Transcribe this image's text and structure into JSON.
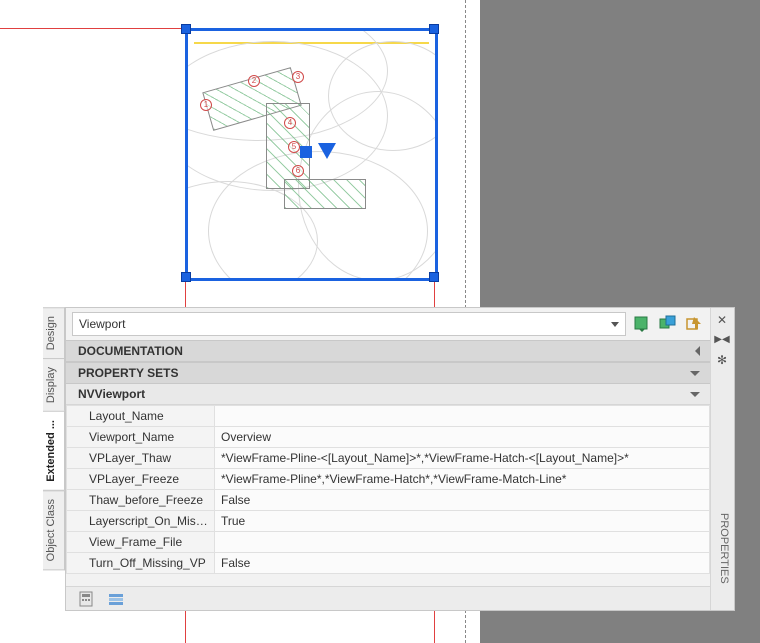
{
  "palette": {
    "title": "PROPERTIES",
    "object_type": "Viewport",
    "sections": {
      "documentation": "DOCUMENTATION",
      "property_sets": "PROPERTY SETS",
      "nvviewport": "NVViewport"
    },
    "props": [
      {
        "key": "Layout_Name",
        "value": ""
      },
      {
        "key": "Viewport_Name",
        "value": "Overview"
      },
      {
        "key": "VPLayer_Thaw",
        "value": "*ViewFrame-Pline-<[Layout_Name]>*,*ViewFrame-Hatch-<[Layout_Name]>*"
      },
      {
        "key": "VPLayer_Freeze",
        "value": "*ViewFrame-Pline*,*ViewFrame-Hatch*,*ViewFrame-Match-Line*"
      },
      {
        "key": "Thaw_before_Freeze",
        "value": "False"
      },
      {
        "key": "Layerscript_On_Missi...",
        "value": "True"
      },
      {
        "key": "View_Frame_File",
        "value": ""
      },
      {
        "key": "Turn_Off_Missing_VP",
        "value": "False"
      }
    ]
  },
  "tabs": {
    "design": "Design",
    "display": "Display",
    "extended": "Extended ...",
    "object_class": "Object Class"
  },
  "rings": {
    "r1": "1",
    "r2": "2",
    "r3": "3",
    "r4": "4",
    "r5": "5",
    "r6": "6"
  }
}
